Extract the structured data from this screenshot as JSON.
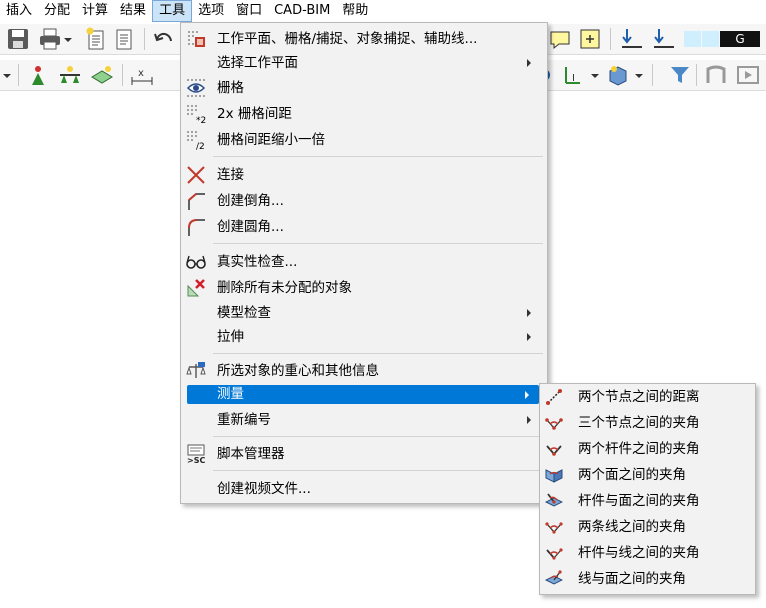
{
  "menubar": {
    "items": [
      {
        "label": "插入"
      },
      {
        "label": "分配"
      },
      {
        "label": "计算"
      },
      {
        "label": "结果"
      },
      {
        "label": "工具"
      },
      {
        "label": "选项"
      },
      {
        "label": "窗口"
      },
      {
        "label": "CAD-BIM"
      },
      {
        "label": "帮助"
      }
    ],
    "active": "工具"
  },
  "toolbar": {
    "g_label": "G"
  },
  "tools_menu": {
    "items": [
      {
        "label": "工作平面、栅格/捕捉、对象捕捉、辅助线...",
        "icon": "grid-settings-icon",
        "submenu": false
      },
      {
        "label": "选择工作平面",
        "icon": "",
        "submenu": true
      },
      {
        "label": "栅格",
        "icon": "grid-eye-icon",
        "submenu": false
      },
      {
        "label": "2x 栅格间距",
        "icon": "grid-double-icon",
        "submenu": false
      },
      {
        "label": "栅格间距缩小一倍",
        "icon": "grid-half-icon",
        "submenu": false
      },
      {
        "label": "连接",
        "icon": "connect-lines-icon",
        "submenu": false
      },
      {
        "label": "创建倒角...",
        "icon": "chamfer-icon",
        "submenu": false
      },
      {
        "label": "创建圆角...",
        "icon": "fillet-icon",
        "submenu": false
      },
      {
        "label": "真实性检查...",
        "icon": "glasses-icon",
        "submenu": false
      },
      {
        "label": "删除所有未分配的对象",
        "icon": "delete-unassigned-icon",
        "submenu": false
      },
      {
        "label": "模型检查",
        "icon": "",
        "submenu": true
      },
      {
        "label": "拉伸",
        "icon": "",
        "submenu": true
      },
      {
        "label": "所选对象的重心和其他信息",
        "icon": "balance-icon",
        "submenu": false
      },
      {
        "label": "测量",
        "icon": "",
        "submenu": true,
        "highlighted": true
      },
      {
        "label": "重新编号",
        "icon": "",
        "submenu": true
      },
      {
        "label": "脚本管理器",
        "icon": "script-manager-icon",
        "submenu": false
      },
      {
        "label": "创建视频文件...",
        "icon": "",
        "submenu": false
      }
    ]
  },
  "measure_submenu": {
    "items": [
      {
        "label": "两个节点之间的距离",
        "icon": "node-distance-icon"
      },
      {
        "label": "三个节点之间的夹角",
        "icon": "angle-three-nodes-icon"
      },
      {
        "label": "两个杆件之间的夹角",
        "icon": "angle-two-members-icon"
      },
      {
        "label": "两个面之间的夹角",
        "icon": "angle-two-surfaces-icon"
      },
      {
        "label": "杆件与面之间的夹角",
        "icon": "angle-member-surface-icon"
      },
      {
        "label": "两条线之间的夹角",
        "icon": "angle-two-lines-icon"
      },
      {
        "label": "杆件与线之间的夹角",
        "icon": "angle-member-line-icon"
      },
      {
        "label": "线与面之间的夹角",
        "icon": "angle-line-surface-icon"
      }
    ]
  }
}
